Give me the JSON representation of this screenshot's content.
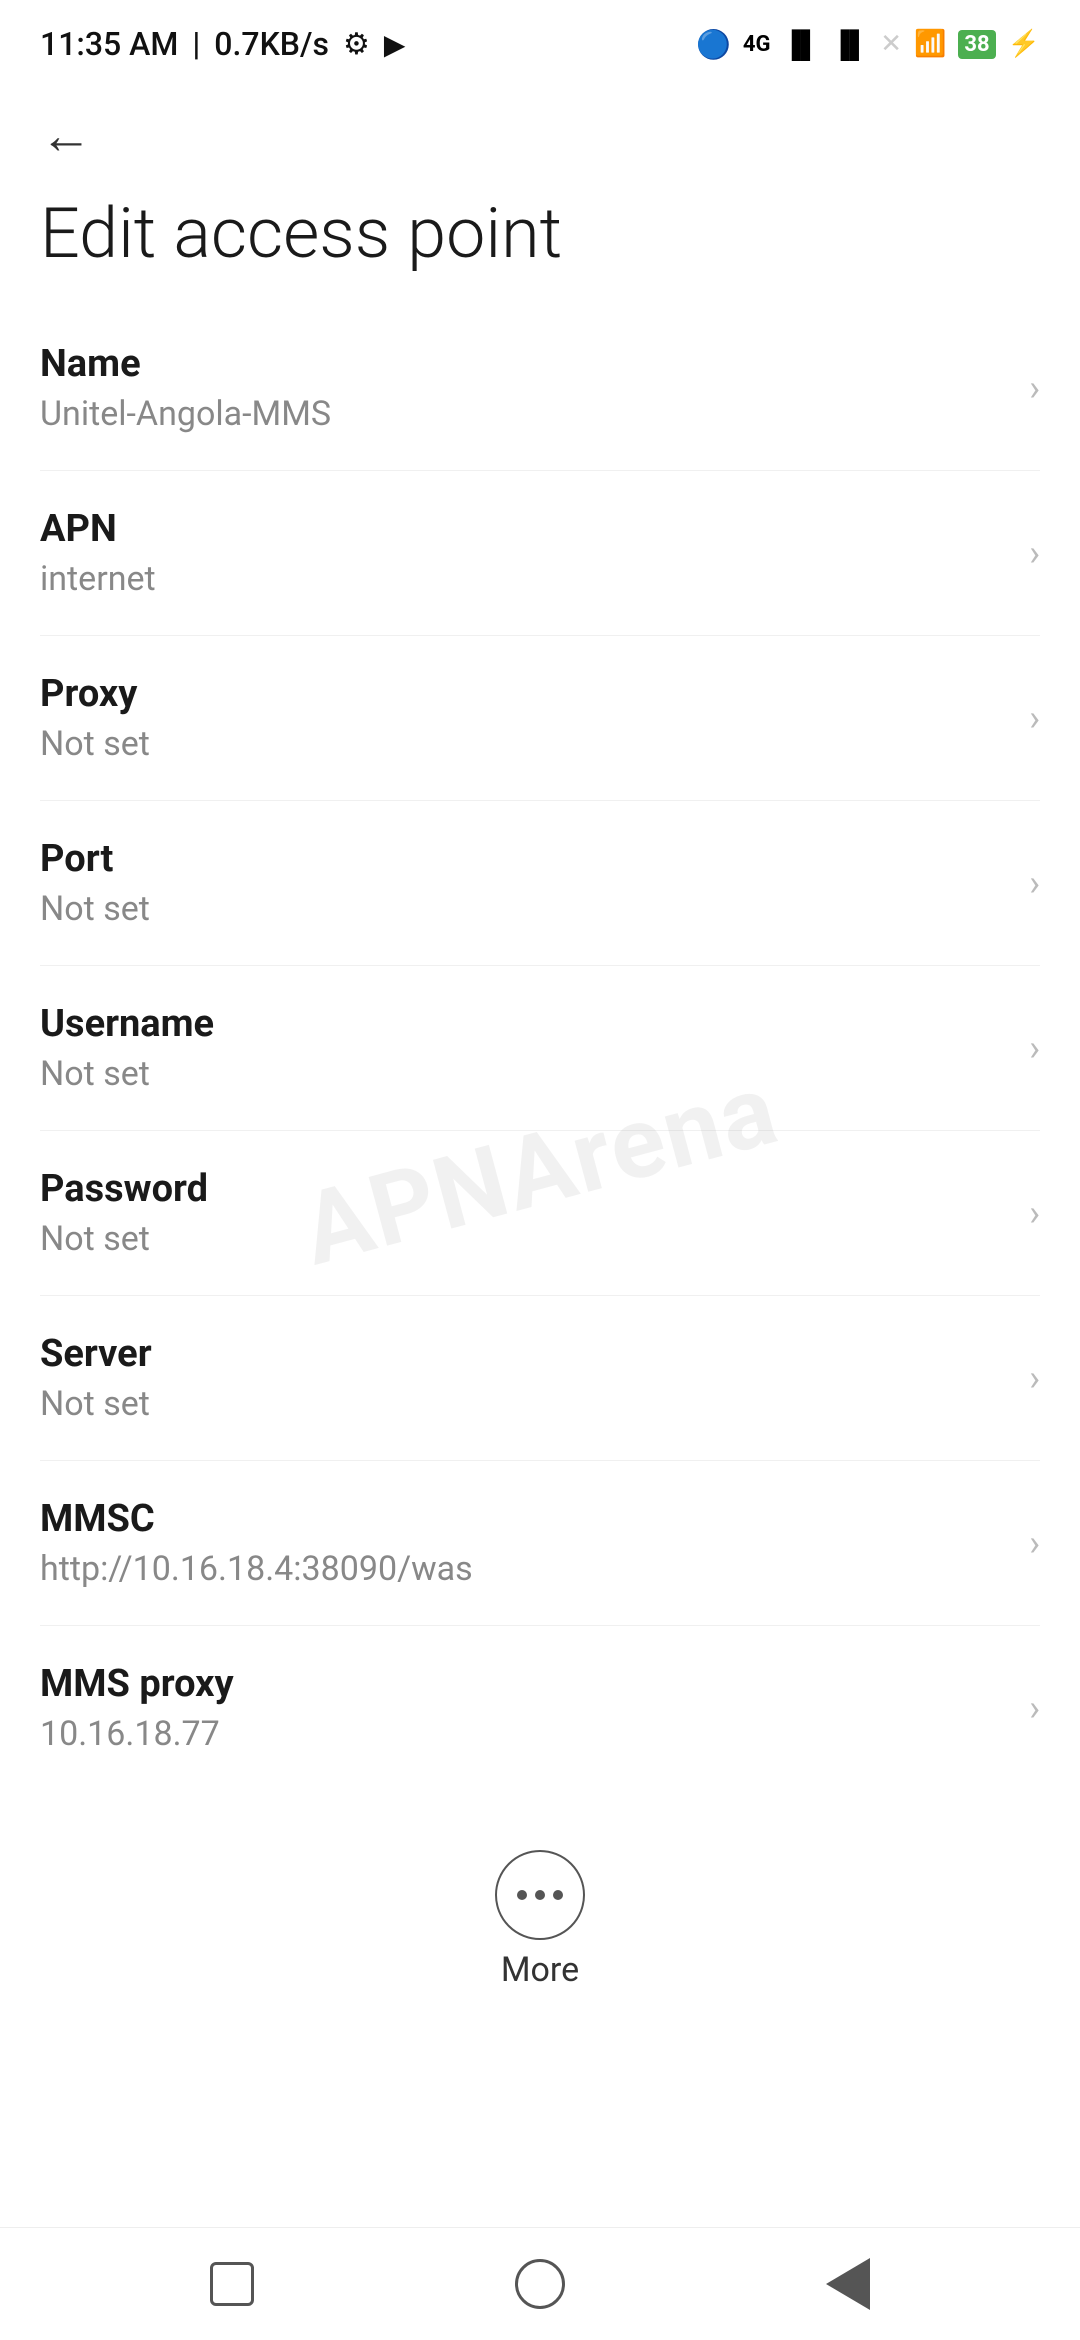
{
  "statusBar": {
    "time": "11:35 AM",
    "speed": "0.7KB/s",
    "battery": "38"
  },
  "page": {
    "title": "Edit access point",
    "backLabel": "←"
  },
  "settings": [
    {
      "label": "Name",
      "value": "Unitel-Angola-MMS"
    },
    {
      "label": "APN",
      "value": "internet"
    },
    {
      "label": "Proxy",
      "value": "Not set"
    },
    {
      "label": "Port",
      "value": "Not set"
    },
    {
      "label": "Username",
      "value": "Not set"
    },
    {
      "label": "Password",
      "value": "Not set"
    },
    {
      "label": "Server",
      "value": "Not set"
    },
    {
      "label": "MMSC",
      "value": "http://10.16.18.4:38090/was"
    },
    {
      "label": "MMS proxy",
      "value": "10.16.18.77"
    }
  ],
  "more": {
    "label": "More"
  },
  "watermark": "APNArena"
}
